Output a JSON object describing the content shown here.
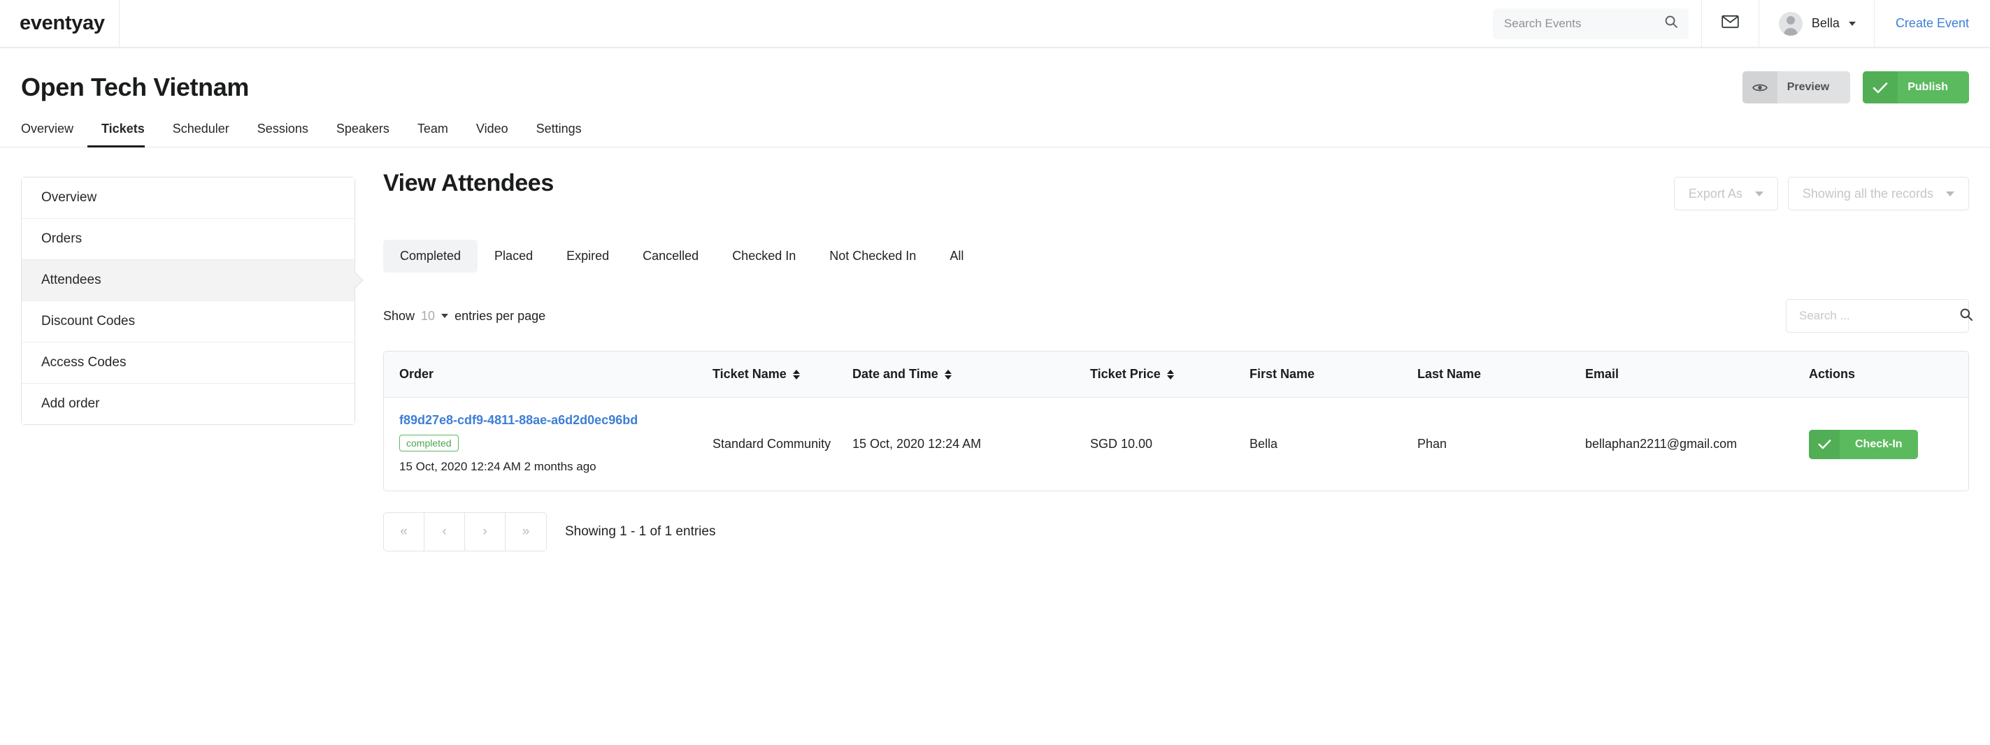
{
  "topbar": {
    "brand": "eventyay",
    "search_placeholder": "Search Events",
    "search_value": "",
    "search_icon": "search-icon",
    "mail_icon": "envelope-icon",
    "user_name": "Bella",
    "create_event": "Create Event",
    "link_color": "#3d7fd6"
  },
  "event": {
    "title": "Open Tech Vietnam",
    "preview_label": "Preview",
    "publish_label": "Publish",
    "preview_icon": "eye-icon",
    "publish_icon": "check-icon",
    "publish_color": "#5bba5e"
  },
  "tabs": [
    {
      "label": "Overview",
      "active": false
    },
    {
      "label": "Tickets",
      "active": true
    },
    {
      "label": "Scheduler",
      "active": false
    },
    {
      "label": "Sessions",
      "active": false
    },
    {
      "label": "Speakers",
      "active": false
    },
    {
      "label": "Team",
      "active": false
    },
    {
      "label": "Video",
      "active": false
    },
    {
      "label": "Settings",
      "active": false
    }
  ],
  "sidebar": {
    "items": [
      {
        "label": "Overview",
        "active": false
      },
      {
        "label": "Orders",
        "active": false
      },
      {
        "label": "Attendees",
        "active": true
      },
      {
        "label": "Discount Codes",
        "active": false
      },
      {
        "label": "Access Codes",
        "active": false
      },
      {
        "label": "Add order",
        "active": false
      }
    ]
  },
  "main": {
    "page_title": "View Attendees",
    "export_as": "Export As",
    "showing_records": "Showing all the records",
    "filter_tabs": [
      {
        "label": "Completed",
        "active": true
      },
      {
        "label": "Placed",
        "active": false
      },
      {
        "label": "Expired",
        "active": false
      },
      {
        "label": "Cancelled",
        "active": false
      },
      {
        "label": "Checked In",
        "active": false
      },
      {
        "label": "Not Checked In",
        "active": false
      },
      {
        "label": "All",
        "active": false
      }
    ],
    "show_label": "Show",
    "entries_count": "10",
    "entries_suffix": "entries per page",
    "search_placeholder": "Search ...",
    "search_value": ""
  },
  "table": {
    "headers": [
      {
        "label": "Order",
        "sortable": false
      },
      {
        "label": "Ticket Name",
        "sortable": true
      },
      {
        "label": "Date and Time",
        "sortable": true
      },
      {
        "label": "Ticket Price",
        "sortable": true
      },
      {
        "label": "First Name",
        "sortable": false
      },
      {
        "label": "Last Name",
        "sortable": false
      },
      {
        "label": "Email",
        "sortable": false
      },
      {
        "label": "Actions",
        "sortable": false
      }
    ],
    "rows": [
      {
        "order_id": "f89d27e8-cdf9-4811-88ae-a6d2d0ec96bd",
        "status": "completed",
        "status_color": "#5bba5e",
        "order_meta": "15 Oct, 2020 12:24 AM 2 months ago",
        "ticket_name": "Standard Community",
        "date_time": "15 Oct, 2020 12:24 AM",
        "ticket_price": "SGD 10.00",
        "first_name": "Bella",
        "last_name": "Phan",
        "email": "bellaphan2211@gmail.com",
        "action_label": "Check-In"
      }
    ]
  },
  "pagination": {
    "first": "«",
    "prev": "‹",
    "next": "›",
    "last": "»",
    "showing": "Showing 1 - 1 of 1 entries"
  }
}
